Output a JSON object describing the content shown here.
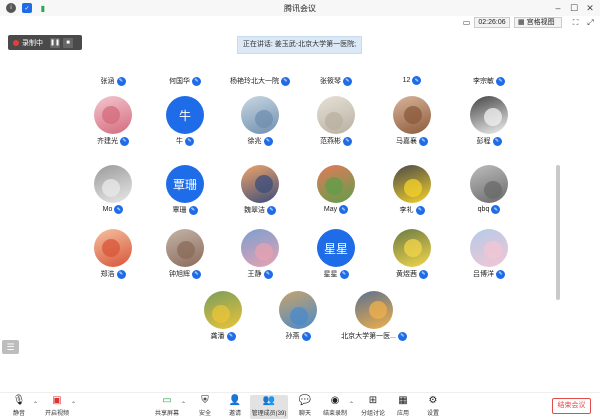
{
  "window": {
    "title": "腾讯会议"
  },
  "header": {
    "timer": "02:26:06",
    "view_label": "宫格视图"
  },
  "recording": {
    "label": "录制中"
  },
  "speaking": {
    "text": "正在讲话: 姜玉武-北京大学第一医院;"
  },
  "colors": {
    "accent": "#1f6ce8",
    "end": "#e24b4b"
  },
  "participants_partial": [
    {
      "name": "张涵"
    },
    {
      "name": "何国华"
    },
    {
      "name": "杨艳玲北大一院"
    },
    {
      "name": "张筱琴"
    },
    {
      "name": "12"
    },
    {
      "name": "李宗敏"
    }
  ],
  "participants": [
    {
      "name": "齐建光",
      "avatar_text": ""
    },
    {
      "name": "牛",
      "avatar_text": "牛"
    },
    {
      "name": "徐兆",
      "avatar_text": ""
    },
    {
      "name": "范燕彬",
      "avatar_text": ""
    },
    {
      "name": "马嘉襄",
      "avatar_text": ""
    },
    {
      "name": "彭程",
      "avatar_text": ""
    },
    {
      "name": "Mo",
      "avatar_text": ""
    },
    {
      "name": "覃珊",
      "avatar_text": "覃珊"
    },
    {
      "name": "魏翠洁",
      "avatar_text": ""
    },
    {
      "name": "May",
      "avatar_text": ""
    },
    {
      "name": "李礼",
      "avatar_text": ""
    },
    {
      "name": "qbq",
      "avatar_text": ""
    },
    {
      "name": "郑浩",
      "avatar_text": ""
    },
    {
      "name": "钟旭辉",
      "avatar_text": ""
    },
    {
      "name": "王静",
      "avatar_text": ""
    },
    {
      "name": "星星",
      "avatar_text": "星星"
    },
    {
      "name": "黄煜茜",
      "avatar_text": ""
    },
    {
      "name": "吕博洋",
      "avatar_text": ""
    },
    {
      "name": "龚潘",
      "avatar_text": ""
    },
    {
      "name": "孙燕",
      "avatar_text": ""
    },
    {
      "name": "北京大学第一医...",
      "avatar_text": ""
    }
  ],
  "toolbar": {
    "mute": "静音",
    "video": "开启视频",
    "share": "共享屏幕",
    "security": "安全",
    "invite": "邀请",
    "members": "管理成员(39)",
    "chat": "聊天",
    "record": "结束录制",
    "breakout": "分组讨论",
    "apps": "应用",
    "settings": "设置",
    "end": "结束会议"
  }
}
